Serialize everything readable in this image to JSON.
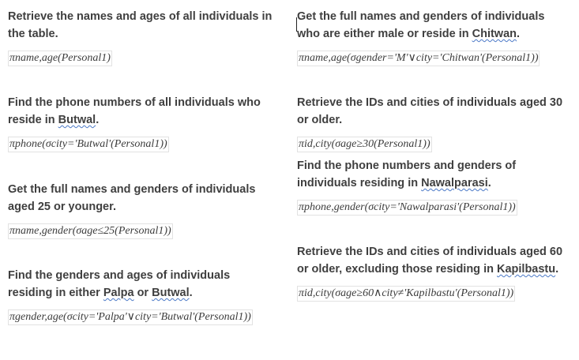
{
  "left_column": [
    {
      "question": "Retrieve the names and ages of all individuals in the table.",
      "formula": "πname,age(Personal1)"
    },
    {
      "question_pre": "Find the phone numbers of all individuals who reside in ",
      "question_place": "Butwal",
      "question_post": ".",
      "formula": "πphone(σcity='Butwal'(Personal1))"
    },
    {
      "question": "Get the full names and genders of individuals aged 25 or younger.",
      "formula": "πname,gender(σage≤25(Personal1))"
    },
    {
      "question_pre": "Find the genders and ages of individuals residing in either ",
      "question_place": "Palpa",
      "question_mid": " or ",
      "question_place2": "Butwal",
      "question_post": ".",
      "formula": "πgender,age(σcity='Palpa'∨city='Butwal'(Personal1))"
    }
  ],
  "right_column": [
    {
      "question_pre": "Get the full names and genders of individuals who are either male or reside in ",
      "question_place": "Chitwan",
      "question_post": ".",
      "formula": "πname,age(σgender='M'∨city='Chitwan'(Personal1))"
    },
    {
      "question": "Retrieve the IDs and cities of individuals aged 30 or older.",
      "formula": "πid,city(σage≥30(Personal1))"
    },
    {
      "question_pre": "Find the phone numbers and genders of individuals residing in ",
      "question_place": "Nawalparasi",
      "question_post": ".",
      "formula": "πphone,gender(σcity='Nawalparasi'(Personal1))"
    },
    {
      "question_pre": "Retrieve the IDs and cities of individuals aged 60 or older, excluding those residing in ",
      "question_place": "Kapilbastu",
      "question_post": ".",
      "formula": "πid,city(σage≥60∧city≠'Kapilbastu'(Personal1))"
    }
  ]
}
